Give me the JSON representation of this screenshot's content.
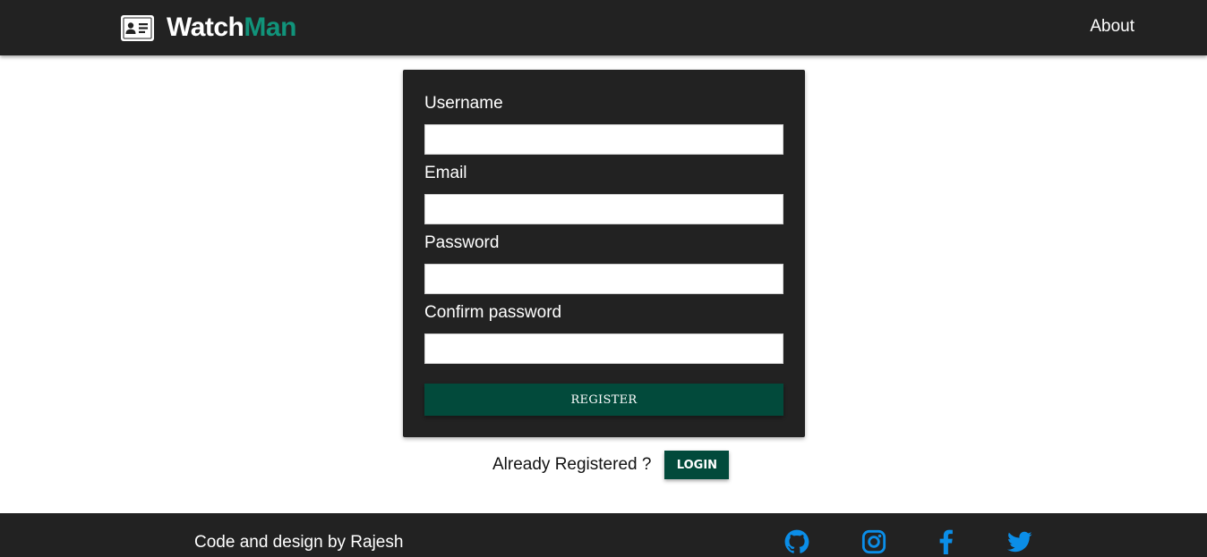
{
  "navbar": {
    "brand_part1": "Watch",
    "brand_part2": "Man",
    "brand_icon": "id-card-icon",
    "about_label": "About"
  },
  "form": {
    "username_label": "Username",
    "email_label": "Email",
    "password_label": "Password",
    "confirm_label": "Confirm password",
    "username_value": "",
    "email_value": "",
    "password_value": "",
    "confirm_value": "",
    "register_label": "REGISTER"
  },
  "login": {
    "prompt": "Already Registered ?",
    "button_label": "LOGIN"
  },
  "footer": {
    "credit": "Code and design by Rajesh",
    "social_icons": [
      "github-icon",
      "instagram-icon",
      "facebook-icon",
      "twitter-icon"
    ]
  },
  "colors": {
    "dark_bg": "#222222",
    "brand_accent": "#11937a",
    "button_green": "#024a3b",
    "social_blue": "#0b8ee8"
  }
}
